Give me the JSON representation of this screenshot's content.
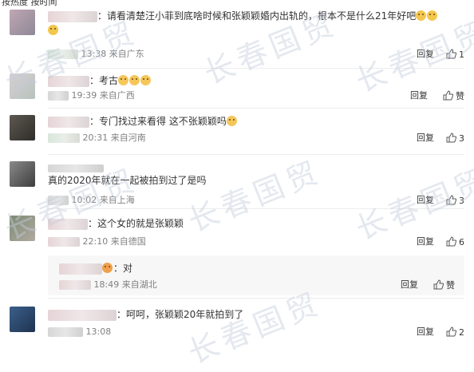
{
  "header": {
    "label": "按热度 按时间"
  },
  "watermark": "长春国贸",
  "reply_label": "回复",
  "like_label": "赞",
  "comments": [
    {
      "text": "：请看清楚汪小菲到底啥时候和张颖颖婚内出轨的，根本不是什么21年好吧",
      "meta": "13:38 来自广东",
      "likes": "1"
    },
    {
      "text": "：考古",
      "meta": "19:39 来自广西",
      "likes": "赞"
    },
    {
      "text": "：专门找过来看得 这不张颖颖吗",
      "meta": "20:31 来自河南",
      "likes": "3"
    },
    {
      "text": "真的2020年就在一起被拍到过了是吗",
      "meta": "10:02 来自上海",
      "likes": "3"
    },
    {
      "text": "：这个女的就是张颖颖",
      "meta": "22:10 来自德国",
      "likes": "6"
    },
    {
      "text": "：呵呵，张颖颖20年就拍到了",
      "meta": "13:08",
      "likes": "2"
    }
  ],
  "nested_reply": {
    "text": "：对",
    "meta": "18:49 来自湖北",
    "likes": "赞"
  }
}
